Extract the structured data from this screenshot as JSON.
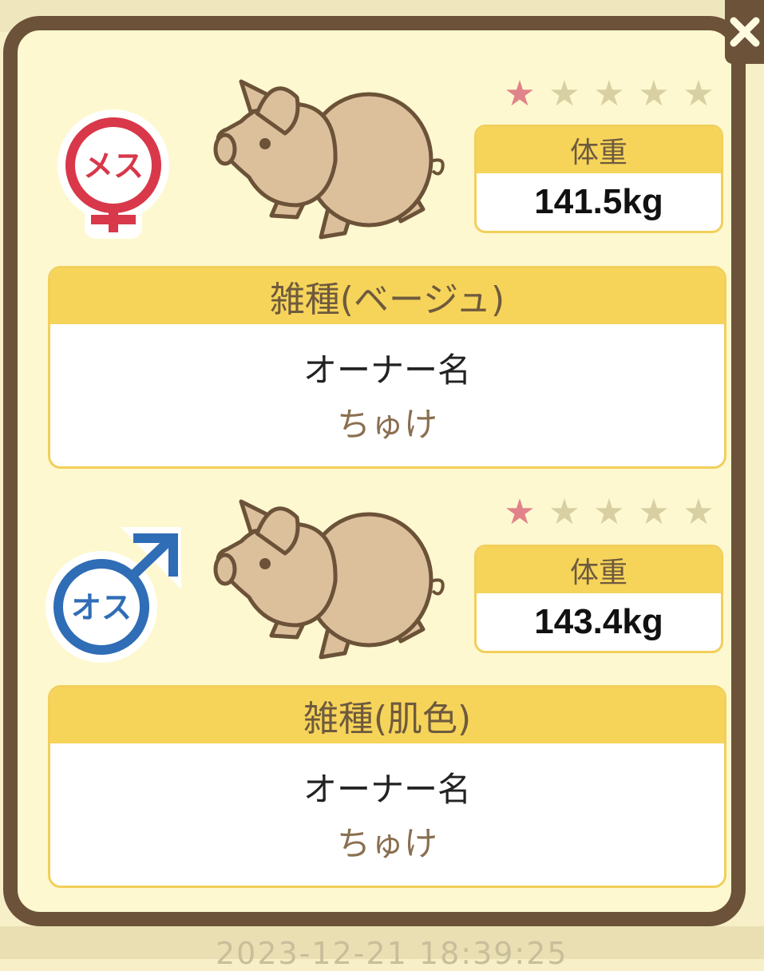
{
  "background": {
    "date_text": "2023-12-21 18:39:25"
  },
  "close_button": {
    "icon": "close-icon"
  },
  "pigs": [
    {
      "gender_label": "メス",
      "gender_icon": "female-icon",
      "gender_color": "#d8384a",
      "rating": 1,
      "max_rating": 5,
      "weight_label": "体重",
      "weight_value": "141.5kg",
      "breed": "雑種(ベージュ)",
      "owner_label": "オーナー名",
      "owner_name": "ちゅけ"
    },
    {
      "gender_label": "オス",
      "gender_icon": "male-icon",
      "gender_color": "#2f6db6",
      "rating": 1,
      "max_rating": 5,
      "weight_label": "体重",
      "weight_value": "143.4kg",
      "breed": "雑種(肌色)",
      "owner_label": "オーナー名",
      "owner_name": "ちゅけ"
    }
  ],
  "colors": {
    "frame": "#6b5238",
    "panel": "#fdf8cf",
    "header_yellow": "#f6d45a",
    "star_on": "#e0838a",
    "star_off": "#d8cfa3"
  }
}
